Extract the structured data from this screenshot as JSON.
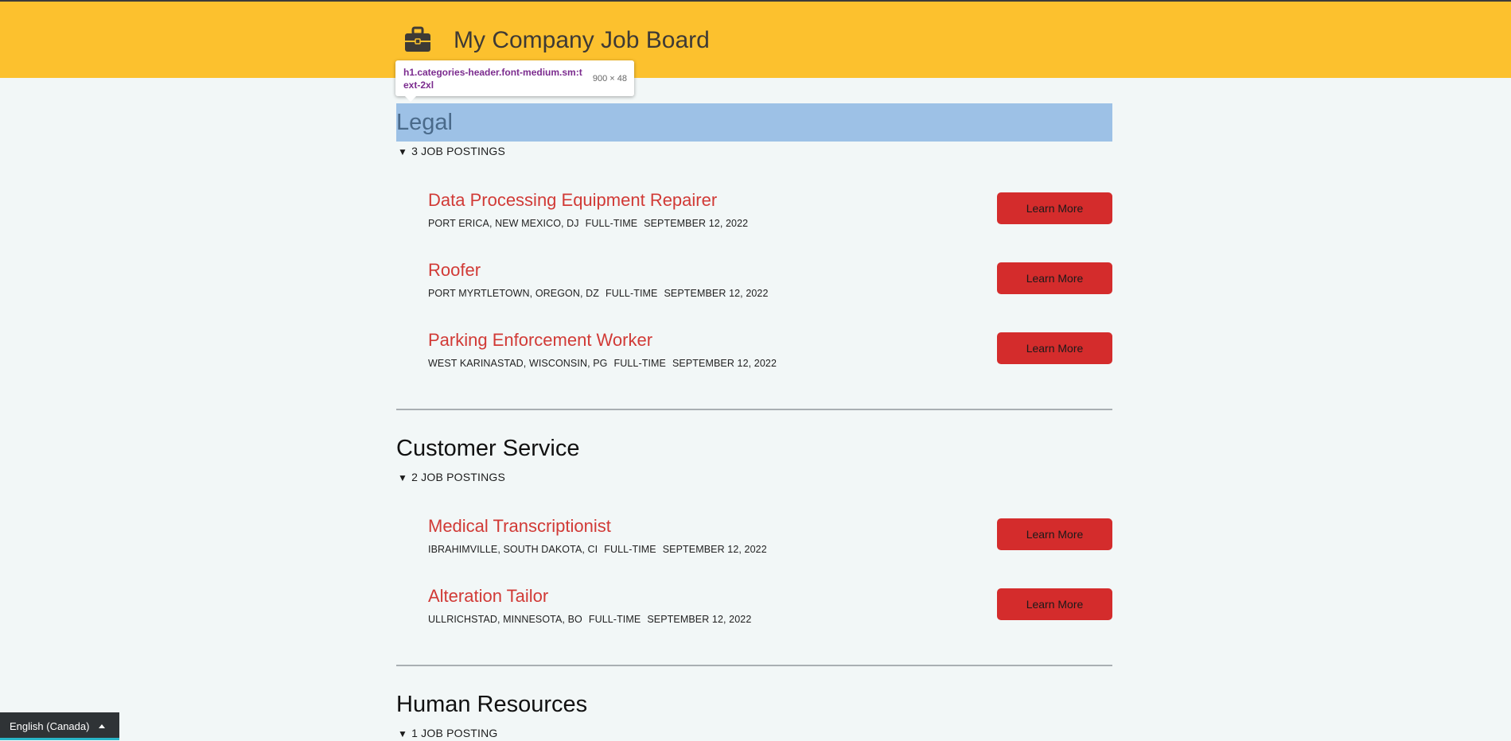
{
  "header": {
    "title": "My Company Job Board",
    "icon": "briefcase-icon",
    "background_color": "#fcc12e"
  },
  "tooltip": {
    "selector": "h1.categories-header.font-medium.sm:text-2xl",
    "size": "900 × 48"
  },
  "sections": [
    {
      "title": "Legal",
      "count_label": "3 JOB POSTINGS",
      "jobs": [
        {
          "title": "Data Processing Equipment Repairer",
          "location": "PORT ERICA, NEW MEXICO, DJ",
          "type": "FULL-TIME",
          "date": "SEPTEMBER 12, 2022",
          "button": "Learn More"
        },
        {
          "title": "Roofer",
          "location": "PORT MYRTLETOWN, OREGON, DZ",
          "type": "FULL-TIME",
          "date": "SEPTEMBER 12, 2022",
          "button": "Learn More"
        },
        {
          "title": "Parking Enforcement Worker",
          "location": "WEST KARINASTAD, WISCONSIN, PG",
          "type": "FULL-TIME",
          "date": "SEPTEMBER 12, 2022",
          "button": "Learn More"
        }
      ]
    },
    {
      "title": "Customer Service",
      "count_label": "2 JOB POSTINGS",
      "jobs": [
        {
          "title": "Medical Transcriptionist",
          "location": "IBRAHIMVILLE, SOUTH DAKOTA, CI",
          "type": "FULL-TIME",
          "date": "SEPTEMBER 12, 2022",
          "button": "Learn More"
        },
        {
          "title": "Alteration Tailor",
          "location": "ULLRICHSTAD, MINNESOTA, BO",
          "type": "FULL-TIME",
          "date": "SEPTEMBER 12, 2022",
          "button": "Learn More"
        }
      ]
    },
    {
      "title": "Human Resources",
      "count_label": "1 JOB POSTING",
      "jobs": []
    }
  ],
  "language": {
    "label": "English (Canada)"
  },
  "colors": {
    "accent": "#d42c2c",
    "job_title": "#d13a36",
    "highlight": "#9dc1e6"
  }
}
